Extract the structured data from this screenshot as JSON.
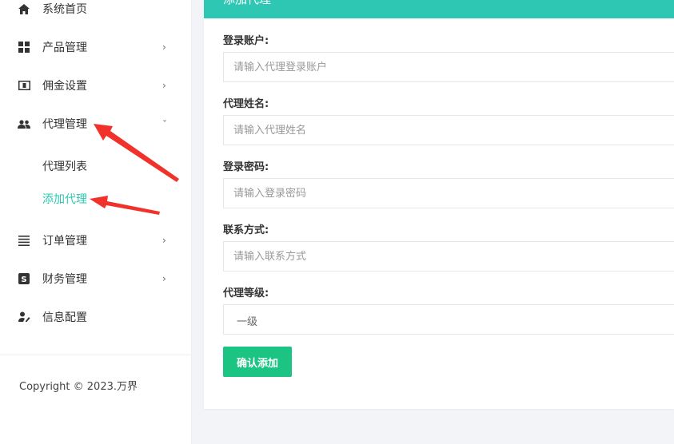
{
  "sidebar": {
    "items": [
      {
        "label": "系统首页",
        "icon": "home-icon",
        "has_chevron": false
      },
      {
        "label": "产品管理",
        "icon": "grid-icon",
        "has_chevron": true
      },
      {
        "label": "佣金设置",
        "icon": "money-icon",
        "has_chevron": true
      },
      {
        "label": "代理管理",
        "icon": "users-icon",
        "has_chevron": true,
        "expanded": true
      },
      {
        "label": "订单管理",
        "icon": "list-icon",
        "has_chevron": true
      },
      {
        "label": "财务管理",
        "icon": "finance-icon",
        "has_chevron": true
      },
      {
        "label": "信息配置",
        "icon": "user-edit-icon",
        "has_chevron": false
      }
    ],
    "sub_items": [
      {
        "label": "代理列表",
        "active": false
      },
      {
        "label": "添加代理",
        "active": true
      }
    ],
    "chevron_right": "›",
    "chevron_down": "ˇ",
    "copyright": "Copyright © 2023.万界"
  },
  "panel": {
    "header_title": "添加代理",
    "fields": [
      {
        "label": "登录账户:",
        "placeholder": "请输入代理登录账户"
      },
      {
        "label": "代理姓名:",
        "placeholder": "请输入代理姓名"
      },
      {
        "label": "登录密码:",
        "placeholder": "请输入登录密码"
      },
      {
        "label": "联系方式:",
        "placeholder": "请输入联系方式"
      }
    ],
    "level": {
      "label": "代理等级:",
      "value": "一级"
    },
    "submit_label": "确认添加"
  },
  "colors": {
    "accent": "#2ec7b3",
    "button": "#1bc482",
    "arrow": "#f0322b"
  }
}
